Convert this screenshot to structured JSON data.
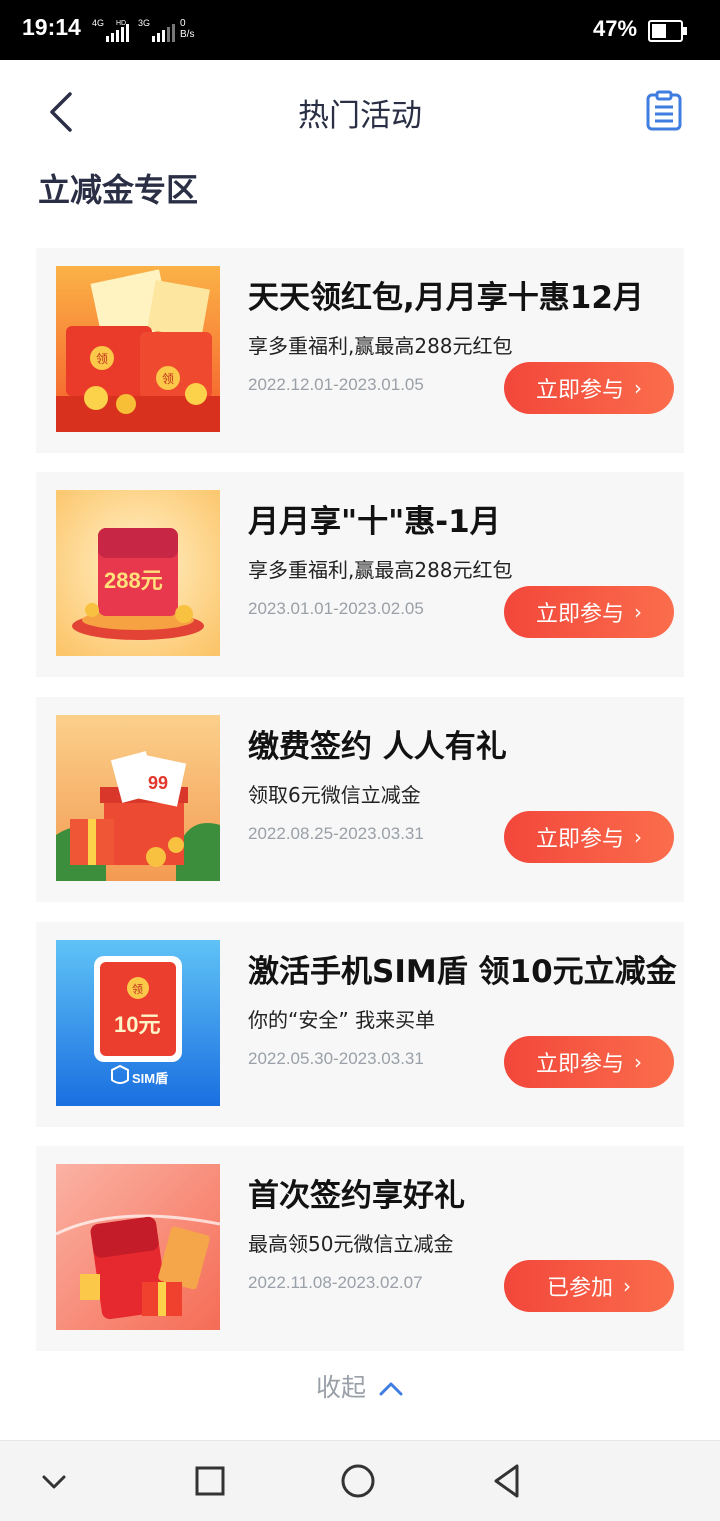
{
  "status_bar": {
    "time": "19:14",
    "net1": "4G",
    "net2": "3G",
    "hd": "HD",
    "speed_value": "0",
    "speed_unit": "B/s",
    "battery": "47%"
  },
  "header": {
    "title": "热门活动",
    "back_icon": "chevron-left-icon",
    "record_icon": "clipboard-list-icon"
  },
  "section": {
    "title": "立减金专区"
  },
  "colors": {
    "accent": "#f2473b",
    "title": "#2a2f45",
    "date": "#9aa0a8",
    "link": "#3f7de0"
  },
  "activities": [
    {
      "title": "天天领红包,月月享十惠12月",
      "desc": "享多重福利,赢最高288元红包",
      "date": "2022.12.01-2023.01.05",
      "button": "立即参与",
      "thumb_text": [
        "领",
        "领"
      ]
    },
    {
      "title": "月月享\"十\"惠-1月",
      "desc": "享多重福利,赢最高288元红包",
      "date": "2023.01.01-2023.02.05",
      "button": "立即参与",
      "thumb_text": [
        "288元"
      ]
    },
    {
      "title": "缴费签约 人人有礼",
      "desc": "领取6元微信立减金",
      "date": "2022.08.25-2023.03.31",
      "button": "立即参与",
      "thumb_text": [
        "99"
      ]
    },
    {
      "title": "激活手机SIM盾 领10元立减金",
      "desc": "你的“安全” 我来买单",
      "date": "2022.05.30-2023.03.31",
      "button": "立即参与",
      "thumb_text": [
        "领",
        "10元",
        "SIM盾"
      ]
    },
    {
      "title": "首次签约享好礼",
      "desc": "最高领50元微信立减金",
      "date": "2022.11.08-2023.02.07",
      "button": "已参加",
      "thumb_text": []
    }
  ],
  "collapse_label": "收起",
  "nav": {
    "hide": "chevron-down-icon",
    "recents": "square-icon",
    "home": "circle-icon",
    "back": "triangle-back-icon"
  }
}
